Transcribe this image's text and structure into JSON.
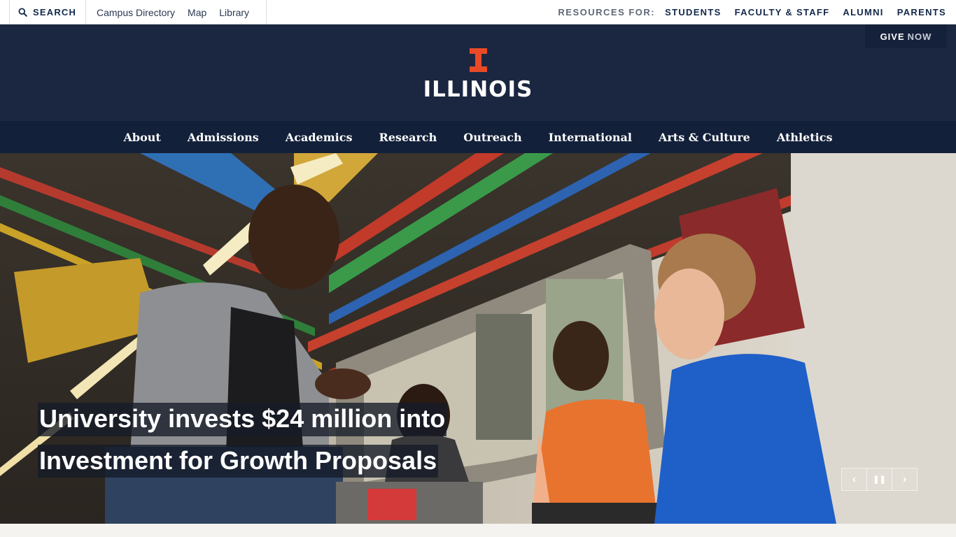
{
  "utility": {
    "search_label": "SEARCH",
    "quick_links": [
      "Campus Directory",
      "Map",
      "Library"
    ],
    "resources_label": "RESOURCES FOR:",
    "resources": [
      "STUDENTS",
      "FACULTY & STAFF",
      "ALUMNI",
      "PARENTS"
    ]
  },
  "header": {
    "give_label": "GIVE",
    "give_now": "NOW",
    "wordmark": "ILLINOIS"
  },
  "nav": [
    "About",
    "Admissions",
    "Academics",
    "Research",
    "Outreach",
    "International",
    "Arts & Culture",
    "Athletics"
  ],
  "hero": {
    "headline_line1": "University invests $24 million into",
    "headline_line2": "Investment for Growth Proposals",
    "controls": {
      "prev": "‹",
      "pause": "❚❚",
      "next": "›"
    }
  },
  "colors": {
    "navy": "#13294b",
    "header_bg": "#1b2740",
    "orange": "#e84a27"
  }
}
